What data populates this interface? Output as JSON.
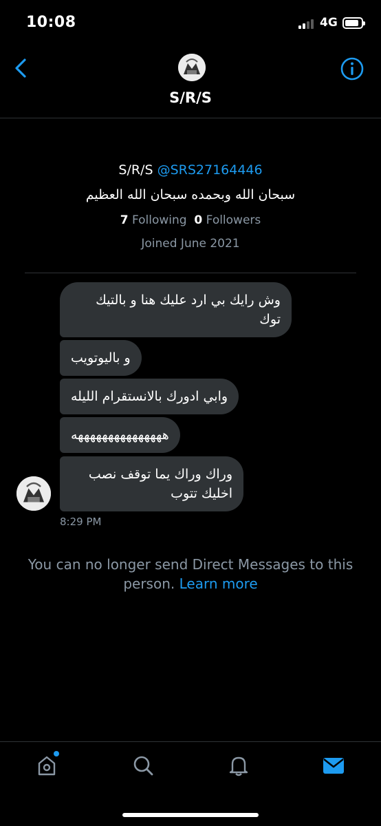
{
  "status_bar": {
    "time": "10:08",
    "network": "4G"
  },
  "header": {
    "name": "S/R/S"
  },
  "profile": {
    "name": "S/R/S",
    "handle": "@SRS27164446",
    "bio": "سبحان الله وبحمده سبحان الله العظيم",
    "following_count": "7",
    "following_label": "Following",
    "followers_count": "0",
    "followers_label": "Followers",
    "joined": "Joined June 2021"
  },
  "messages": [
    {
      "text": "وش رايك بي ارد عليك هنا و بالتيك توك"
    },
    {
      "text": "و باليوتويب"
    },
    {
      "text": "وابي ادورك بالانستقرام الليله"
    },
    {
      "text": "هههههههههههههههه"
    },
    {
      "text": "وراك وراك يما توقف نصب اخليك تتوب"
    }
  ],
  "last_message_time": "8:29 PM",
  "notice": {
    "text": "You can no longer send Direct Messages to this person.",
    "link": "Learn more"
  },
  "tabbar": {
    "items": [
      "home-icon",
      "search-icon",
      "notifications-icon",
      "messages-icon"
    ],
    "active": "messages-icon",
    "accent": "#1d9bf0"
  }
}
